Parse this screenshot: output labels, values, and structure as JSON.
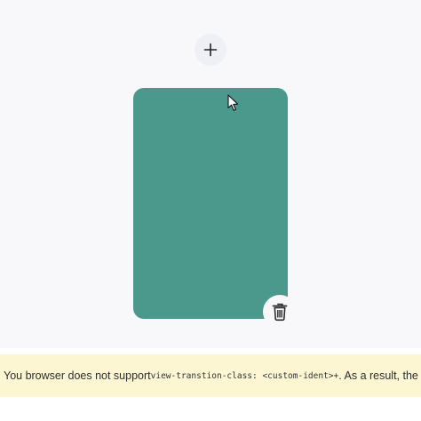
{
  "colors": {
    "card": "#4b998d",
    "notice_background": "#fcf6d3"
  },
  "controls": {
    "add_icon": "plus-icon",
    "delete_icon": "trash-icon"
  },
  "notice": {
    "text_before": "You browser does not support ",
    "code": "view-transtion-class: <custom-ident>+",
    "text_after": ". As a result, the"
  }
}
